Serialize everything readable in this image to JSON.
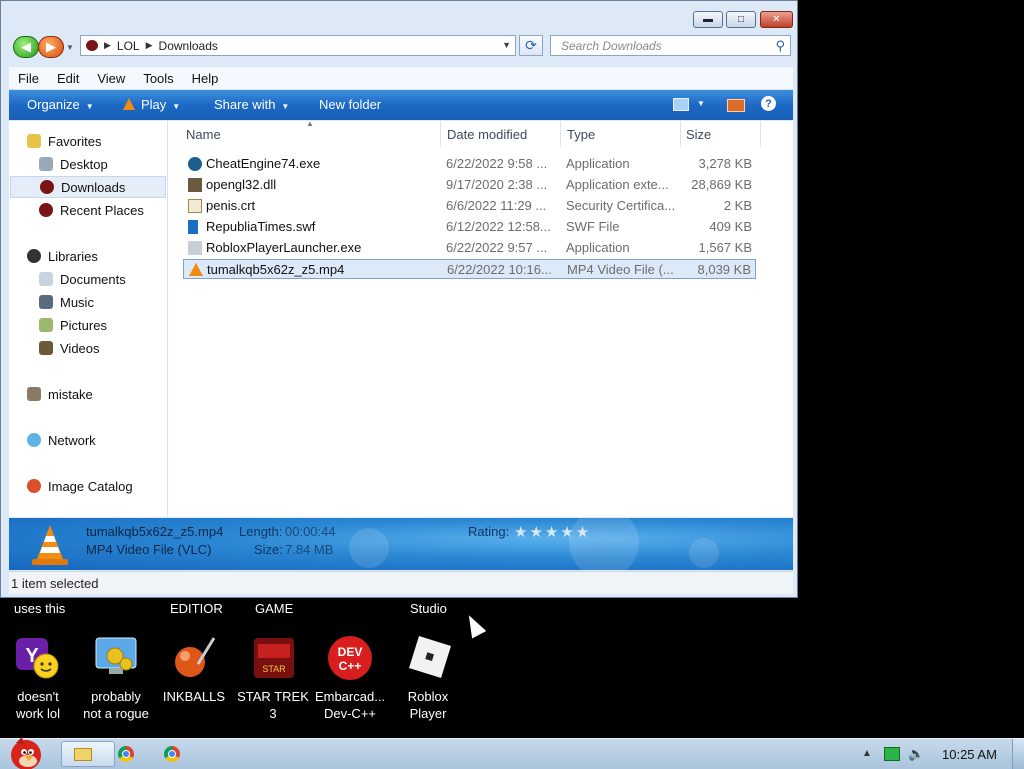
{
  "window": {
    "address": [
      "LOL",
      "Downloads"
    ],
    "search_placeholder": "Search Downloads",
    "menu": [
      "File",
      "Edit",
      "View",
      "Tools",
      "Help"
    ],
    "commands": {
      "organize": "Organize",
      "play": "Play",
      "share": "Share with",
      "new_folder": "New folder"
    },
    "nav": {
      "favorites": "Favorites",
      "desktop": "Desktop",
      "downloads": "Downloads",
      "recent": "Recent Places",
      "libraries": "Libraries",
      "documents": "Documents",
      "music": "Music",
      "pictures": "Pictures",
      "videos": "Videos",
      "user": "mistake",
      "network": "Network",
      "image_catalog": "Image Catalog"
    },
    "columns": {
      "name": "Name",
      "date": "Date modified",
      "type": "Type",
      "size": "Size"
    },
    "files": [
      {
        "name": "CheatEngine74.exe",
        "date": "6/22/2022 9:58 ...",
        "type": "Application",
        "size": "3,278 KB",
        "icon": "cheat-engine-icon"
      },
      {
        "name": "opengl32.dll",
        "date": "9/17/2020 2:38 ...",
        "type": "Application exte...",
        "size": "28,869 KB",
        "icon": "dll-icon"
      },
      {
        "name": "penis.crt",
        "date": "6/6/2022 11:29 ...",
        "type": "Security Certifica...",
        "size": "2 KB",
        "icon": "certificate-icon"
      },
      {
        "name": "RepubliaTimes.swf",
        "date": "6/12/2022 12:58...",
        "type": "SWF File",
        "size": "409 KB",
        "icon": "swf-icon"
      },
      {
        "name": "RobloxPlayerLauncher.exe",
        "date": "6/22/2022 9:57 ...",
        "type": "Application",
        "size": "1,567 KB",
        "icon": "roblox-icon"
      },
      {
        "name": "tumalkqb5x62z_z5.mp4",
        "date": "6/22/2022 10:16...",
        "type": "MP4 Video File (...",
        "size": "8,039 KB",
        "icon": "vlc-icon"
      }
    ],
    "details": {
      "name": "tumalkqb5x62z_z5.mp4",
      "type": "MP4 Video File (VLC)",
      "length_label": "Length:",
      "length": "00:00:44",
      "size_label": "Size:",
      "size": "7.84 MB",
      "rating_label": "Rating:",
      "rating": "★★★★★"
    },
    "status": "1 item selected"
  },
  "desktop": {
    "top_labels": [
      "uses this",
      "EDITIOR",
      "GAME",
      "Studio"
    ],
    "icons": [
      {
        "label_line1": "doesn't",
        "label_line2": "work lol",
        "icon": "yahoo-messenger-icon"
      },
      {
        "label_line1": "probably",
        "label_line2": "not a rogue",
        "icon": "control-panel-icon"
      },
      {
        "label_line1": "INKBALLS",
        "label_line2": "",
        "icon": "inkball-icon"
      },
      {
        "label_line1": "STAR TREK",
        "label_line2": "3",
        "icon": "star-trek-icon"
      },
      {
        "label_line1": "Embarcad...",
        "label_line2": "Dev-C++",
        "icon": "dev-cpp-icon"
      },
      {
        "label_line1": "Roblox",
        "label_line2": "Player",
        "icon": "roblox-studio-icon"
      }
    ]
  },
  "taskbar": {
    "clock": "10:25 AM"
  },
  "colors": {
    "command_bar": "#1c69c5",
    "details_bg": "#2a86d2",
    "desktop": "#000000",
    "taskbar": "#b8cfe4"
  }
}
